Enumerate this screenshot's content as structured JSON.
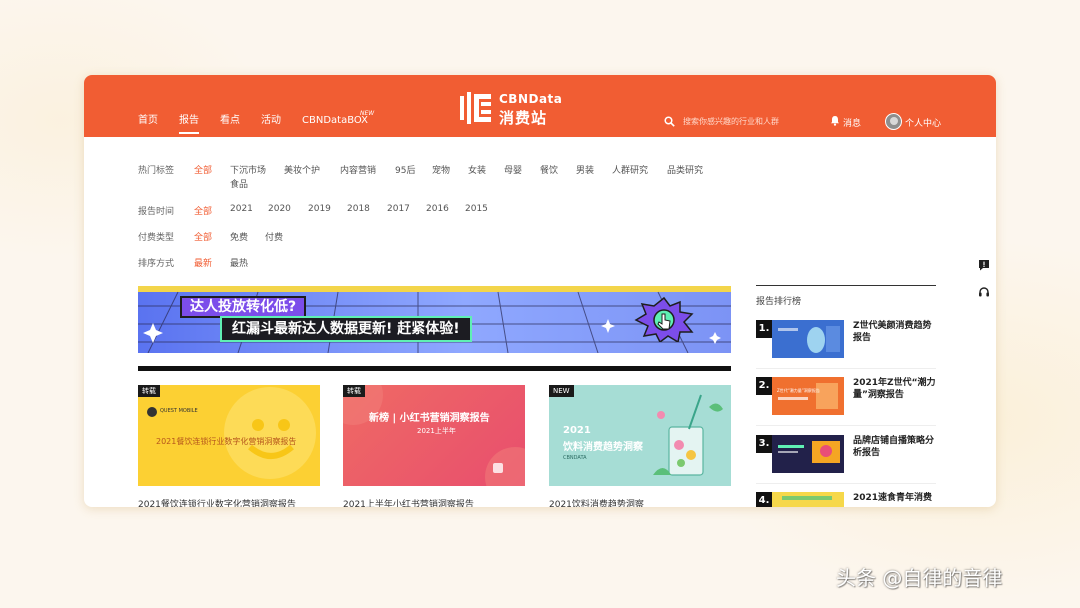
{
  "nav": {
    "items": [
      "首页",
      "报告",
      "看点",
      "活动",
      "CBNDataBOX"
    ],
    "new_badge": "NEW",
    "active": "报告"
  },
  "logo": {
    "en": "CBNData",
    "cn": "消费站"
  },
  "search": {
    "placeholder": "搜索你感兴趣的行业和人群",
    "icon": "search-icon"
  },
  "header_right": {
    "messages": "消息",
    "user_center": "个人中心"
  },
  "filters": {
    "hot_tags": {
      "label": "热门标签",
      "options": [
        "全部",
        "下沉市场",
        "美妆个护",
        "内容营销",
        "95后",
        "宠物",
        "女装",
        "母婴",
        "餐饮",
        "男装",
        "人群研究",
        "品类研究",
        "食品"
      ]
    },
    "report_time": {
      "label": "报告时间",
      "options": [
        "全部",
        "2021",
        "2020",
        "2019",
        "2018",
        "2017",
        "2016",
        "2015"
      ]
    },
    "payment_type": {
      "label": "付费类型",
      "options": [
        "全部",
        "免费",
        "付费"
      ]
    },
    "sort": {
      "label": "排序方式",
      "options": [
        "最新",
        "最热"
      ]
    }
  },
  "banner": {
    "question": "达人投放转化低?",
    "headline": "红漏斗最新达人数据更新! 赶紧体验!"
  },
  "cards": [
    {
      "tag": "转载",
      "logo_text": "QUEST MOBILE",
      "cover_title": "2021餐饮连锁行业数字化营销洞察报告",
      "title": "2021餐饮连锁行业数字化营销洞察报告"
    },
    {
      "tag": "转载",
      "cover_title": "新榜 | 小红书营销洞察报告",
      "cover_sub": "2021上半年",
      "title": "2021上半年小红书营销洞察报告"
    },
    {
      "tag": "NEW",
      "cover_title": "2021\n饮料消费趋势洞察",
      "cover_year": "2021",
      "cover_line": "饮料消费趋势洞察",
      "cover_small": "CBNDATA",
      "title": "2021饮料消费趋势洞察"
    }
  ],
  "ranking": {
    "title": "报告排行榜",
    "items": [
      {
        "num": "1.",
        "title": "Z世代美颜消费趋势报告"
      },
      {
        "num": "2.",
        "title": "2021年Z世代“潮力量”洞察报告",
        "thumb_text": "Z世代“潮力量”洞察报告"
      },
      {
        "num": "3.",
        "title": "品牌店铺自播策略分析报告"
      },
      {
        "num": "4.",
        "title": "2021速食青年消费"
      }
    ]
  },
  "watermark": "头条 @自律的音律",
  "colors": {
    "accent": "#f15d33",
    "banner_bg": "#7c93f5",
    "card1_bg": "#fcd033",
    "card2_bg": "#ee5a68",
    "card3_bg": "#a6ddd5"
  }
}
